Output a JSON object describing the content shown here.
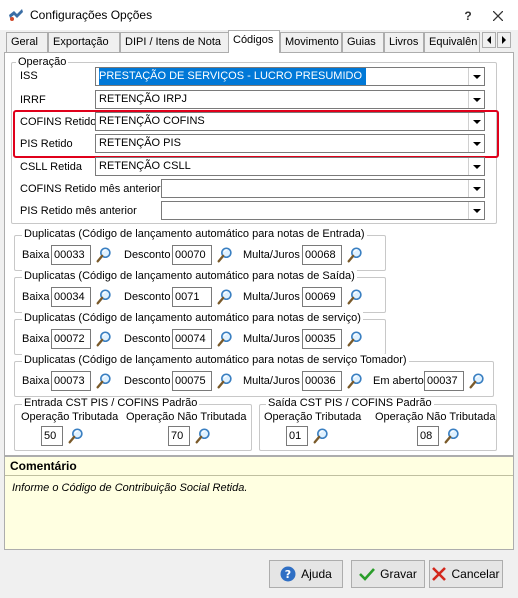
{
  "window": {
    "title": "Configurações Opções"
  },
  "tabs": [
    {
      "label": "Geral"
    },
    {
      "label": "Exportação"
    },
    {
      "label": "DIPI / Itens de Nota"
    },
    {
      "label": "Códigos",
      "active": true
    },
    {
      "label": "Movimento"
    },
    {
      "label": "Guias"
    },
    {
      "label": "Livros"
    },
    {
      "label": "Equivalên"
    }
  ],
  "operacao": {
    "legend": "Operação",
    "rows": [
      {
        "label": "ISS",
        "value": "PRESTAÇÃO DE SERVIÇOS - LUCRO PRESUMIDO",
        "selected": true
      },
      {
        "label": "IRRF",
        "value": "RETENÇÃO IRPJ"
      },
      {
        "label": "COFINS Retido",
        "value": "RETENÇÃO COFINS"
      },
      {
        "label": "PIS Retido",
        "value": "RETENÇÃO PIS"
      },
      {
        "label": "CSLL Retida",
        "value": "RETENÇÃO CSLL"
      },
      {
        "label": "COFINS Retido mês anterior",
        "value": ""
      },
      {
        "label": "PIS Retido mês anterior",
        "value": ""
      }
    ]
  },
  "duplicatas": [
    {
      "legend": "Duplicatas (Código de  lançamento automático para notas de Entrada)",
      "fields": [
        {
          "label": "Baixa",
          "value": "00033"
        },
        {
          "label": "Desconto",
          "value": "00070"
        },
        {
          "label": "Multa/Juros",
          "value": "00068"
        }
      ]
    },
    {
      "legend": "Duplicatas (Código de  lançamento automático para notas de Saída)",
      "fields": [
        {
          "label": "Baixa",
          "value": "00034"
        },
        {
          "label": "Desconto",
          "value": "0071"
        },
        {
          "label": "Multa/Juros",
          "value": "00069"
        }
      ]
    },
    {
      "legend": "Duplicatas (Código de  lançamento automático para notas de serviço)",
      "fields": [
        {
          "label": "Baixa",
          "value": "00072"
        },
        {
          "label": "Desconto",
          "value": "00074"
        },
        {
          "label": "Multa/Juros",
          "value": "00035"
        }
      ]
    },
    {
      "legend": "Duplicatas (Código de  lançamento automático para notas de serviço Tomador)",
      "fields": [
        {
          "label": "Baixa",
          "value": "00073"
        },
        {
          "label": "Desconto",
          "value": "00075"
        },
        {
          "label": "Multa/Juros",
          "value": "00036"
        },
        {
          "label": "Em aberto",
          "value": "00037"
        }
      ]
    }
  ],
  "cst_entrada": {
    "legend": "Entrada CST PIS / COFINS Padrão",
    "trib_label": "Operação Tributada",
    "trib_value": "50",
    "nao_trib_label": "Operação Não Tributada",
    "nao_trib_value": "70"
  },
  "cst_saida": {
    "legend": "Saída CST PIS / COFINS Padrão",
    "trib_label": "Operação Tributada",
    "trib_value": "01",
    "nao_trib_label": "Operação Não Tributada",
    "nao_trib_value": "08"
  },
  "comment": {
    "title": "Comentário",
    "text": "Informe o Código de Contribuição Social Retida."
  },
  "buttons": {
    "help": {
      "label": "Ajuda",
      "icon": "help-icon"
    },
    "save": {
      "label": "Gravar",
      "icon": "check-icon"
    },
    "cancel": {
      "label": "Cancelar",
      "icon": "x-icon"
    }
  },
  "colors": {
    "selection": "#0078d7",
    "highlight_box": "#e0001b",
    "comment_bg": "#ffffe1"
  }
}
